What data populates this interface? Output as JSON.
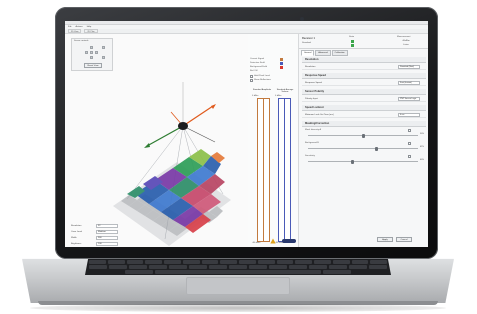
{
  "app": {
    "menu": [
      "File",
      "Actions",
      "Help"
    ],
    "toolbar": [
      "3D View",
      "2D Plan"
    ],
    "nav_panel": {
      "title": "Scene controls",
      "reset_label": "Reset View"
    }
  },
  "view_panel": {
    "rows": [
      {
        "label": "Resolution",
        "value": "32"
      },
      {
        "label": "Cone Level",
        "value": "Medium"
      },
      {
        "label": "Width",
        "value": "360"
      },
      {
        "label": "Brightness",
        "value": "100"
      }
    ]
  },
  "meters": {
    "legend": [
      "Current Signal",
      "Detection Field",
      "Background Field",
      "Ref. Fill",
      "Hold Peak Level",
      "Show Reflections"
    ],
    "left": {
      "label": "Standard Amplitude",
      "top": "0 dBm",
      "bottom": "-80 dBm"
    },
    "right": {
      "label": "Standard Average Volume",
      "top": "0 dBm",
      "bottom": "-80 dBm"
    },
    "colors": {
      "left": "#c27a3e",
      "right": "#4a5ab8"
    }
  },
  "device": {
    "name": "Receiver 1",
    "sub": "Standard",
    "state_label": "State",
    "measure_label": "Measurement",
    "measure_value": "-80dBm",
    "measure_sub": "Listen",
    "status_color": "#3aa54a"
  },
  "tabs": [
    "General",
    "Advanced",
    "Calibration"
  ],
  "sections": {
    "resolution": {
      "title": "Resolution",
      "row": {
        "label": "Resolution",
        "value": "Standard (Med)"
      }
    },
    "response": {
      "title": "Response Speed",
      "row": {
        "label": "Response Speed",
        "value": "Fast (Instant)"
      }
    },
    "polarity": {
      "title": "Sensor Polarity",
      "row": {
        "label": "Polarity Input",
        "value": "PNP Source Logic"
      }
    },
    "lockout": {
      "title": "Speed Lockout",
      "row": {
        "label": "Minimum Lock-Out Time (ms)",
        "value": "0 ms"
      }
    },
    "masking": {
      "title": "Masking/Correction",
      "sliders": [
        {
          "label": "Mask Intensity A",
          "value": 50,
          "pct": "50%"
        },
        {
          "label": "Background B",
          "value": 62,
          "pct": "62%"
        },
        {
          "label": "Sensitivity",
          "value": 40,
          "pct": "40%"
        }
      ]
    }
  },
  "buttons": {
    "apply": "Apply",
    "cancel": "Cancel"
  },
  "transport": {
    "colors": [
      "#d9392f",
      "#2e3033",
      "#2e3033",
      "#2e3033"
    ],
    "icons": [
      "record-icon",
      "play-icon",
      "stop-icon",
      "refresh-icon"
    ]
  }
}
